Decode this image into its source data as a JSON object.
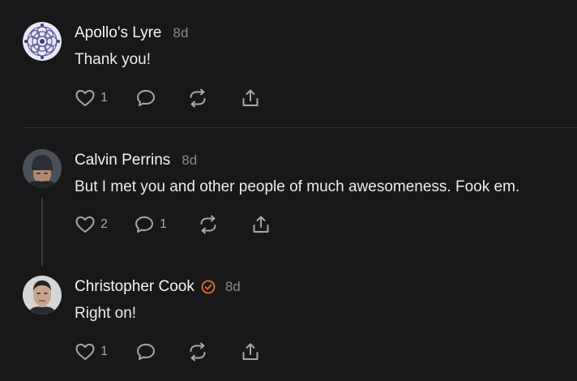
{
  "comments": [
    {
      "author": "Apollo's Lyre",
      "time": "8d",
      "text": "Thank you!",
      "likes": "1",
      "replies": "",
      "avatar_icon": "mandala-avatar"
    },
    {
      "author": "Calvin Perrins",
      "time": "8d",
      "text": "But I met you and other people of much awesomeness. Fook em.",
      "likes": "2",
      "replies": "1",
      "avatar_icon": "beanie-man-avatar"
    },
    {
      "author": "Christopher Cook",
      "time": "8d",
      "text": "Right on!",
      "likes": "1",
      "replies": "",
      "verified": true,
      "verified_color": "#e8722c",
      "avatar_icon": "man-portrait-avatar"
    }
  ],
  "colors": {
    "background": "#18181a",
    "text": "#f2f2f2",
    "muted": "#8a8a8e",
    "icon": "#a8a8ac",
    "divider": "#2e2e31",
    "verified_accent": "#e8722c"
  },
  "icons": {
    "like": "heart-icon",
    "reply": "comment-bubble-icon",
    "restack": "restack-icon",
    "share": "share-icon",
    "verified": "verified-check-icon"
  }
}
